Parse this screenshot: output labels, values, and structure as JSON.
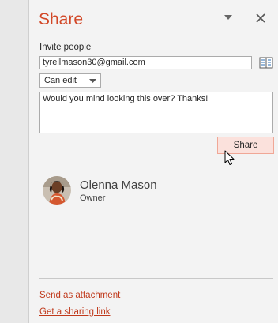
{
  "panel": {
    "title": "Share"
  },
  "invite": {
    "label": "Invite people",
    "email_value": "tyrellmason30@gmail.com"
  },
  "permission": {
    "selected": "Can edit"
  },
  "message": {
    "value": "Would you mind looking this over? Thanks!"
  },
  "share_button": {
    "label": "Share"
  },
  "shared_with": [
    {
      "name": "Olenna Mason",
      "role": "Owner"
    }
  ],
  "links": {
    "send_attachment": "Send as attachment",
    "sharing_link": "Get a sharing link"
  },
  "icons": {
    "task_pane_options": "chevron-down-icon",
    "close": "close-icon",
    "address_book": "address-book-icon",
    "dropdown": "chevron-down-icon",
    "cursor": "mouse-pointer-icon"
  },
  "colors": {
    "accent": "#d24726",
    "link": "#c0391b",
    "share_button_bg": "#fbe1dc",
    "share_button_border": "#f0a796",
    "panel_bg": "#f3f3f3"
  }
}
